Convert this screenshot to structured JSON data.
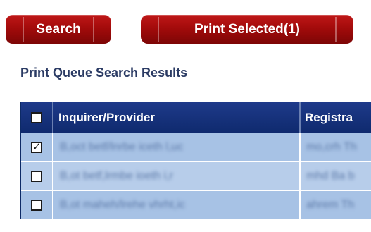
{
  "toolbar": {
    "search_label": "Search",
    "print_selected_label": "Print Selected(1)"
  },
  "section": {
    "title": "Print Queue Search Results"
  },
  "table": {
    "columns": [
      "Inquirer/Provider",
      "Registra"
    ],
    "rows": [
      {
        "checked": true,
        "inquirer": "B,oct betf/lnrbe iceth l,uc",
        "registrar": "mo,crh Th"
      },
      {
        "checked": false,
        "inquirer": "B,ot betf,lrmbe ioeth i,r",
        "registrar": "mhd Ba b"
      },
      {
        "checked": false,
        "inquirer": "B,ot maheh/lrehe vhrht,ic",
        "registrar": "ahrem Th"
      }
    ]
  },
  "colors": {
    "button_red": "#a30b0b",
    "header_navy": "#0f2a6e",
    "row_blue": "#a7c2e5",
    "title_text": "#2b3b64"
  }
}
